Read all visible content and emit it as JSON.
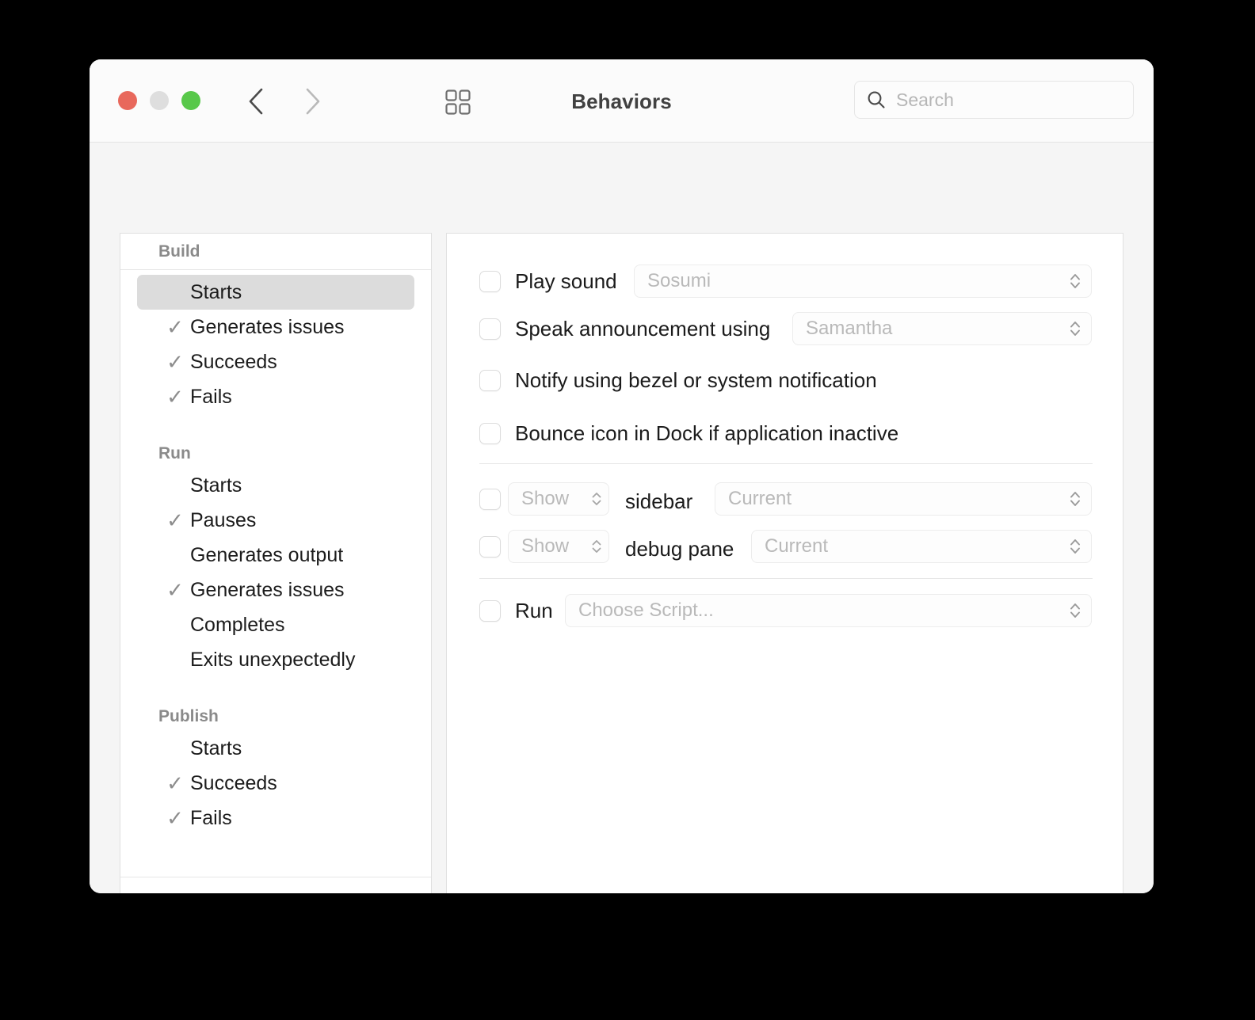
{
  "window": {
    "title": "Behaviors",
    "traffic_lights": {
      "close_color": "#e8685c",
      "minimize_color": "#dedede",
      "maximize_color": "#58c84a"
    },
    "toolbar": {
      "back_icon": "chevron-left-icon",
      "forward_icon": "chevron-right-icon",
      "grid_icon": "grid-view-icon"
    },
    "search": {
      "icon": "search-icon",
      "value": "",
      "placeholder": "Search"
    }
  },
  "sidebar": {
    "header_title": "Build",
    "groups": [
      {
        "name": "Build",
        "show_header_in_list": false,
        "items": [
          {
            "label": "Starts",
            "checked": false,
            "selected": true
          },
          {
            "label": "Generates issues",
            "checked": true,
            "selected": false
          },
          {
            "label": "Succeeds",
            "checked": true,
            "selected": false
          },
          {
            "label": "Fails",
            "checked": true,
            "selected": false
          }
        ]
      },
      {
        "name": "Run",
        "show_header_in_list": true,
        "items": [
          {
            "label": "Starts",
            "checked": false,
            "selected": false
          },
          {
            "label": "Pauses",
            "checked": true,
            "selected": false
          },
          {
            "label": "Generates output",
            "checked": false,
            "selected": false
          },
          {
            "label": "Generates issues",
            "checked": true,
            "selected": false
          },
          {
            "label": "Completes",
            "checked": false,
            "selected": false
          },
          {
            "label": "Exits unexpectedly",
            "checked": false,
            "selected": false
          }
        ]
      },
      {
        "name": "Publish",
        "show_header_in_list": true,
        "items": [
          {
            "label": "Starts",
            "checked": false,
            "selected": false
          },
          {
            "label": "Succeeds",
            "checked": true,
            "selected": false
          },
          {
            "label": "Fails",
            "checked": true,
            "selected": false
          }
        ]
      }
    ],
    "footer": {
      "add_label": "+",
      "remove_label": "–"
    },
    "checkmark_glyph": "✓"
  },
  "detail": {
    "play_sound": {
      "label": "Play sound",
      "checked": false,
      "popup_value": "Sosumi"
    },
    "speak_announcement": {
      "label": "Speak announcement using",
      "checked": false,
      "popup_value": "Samantha"
    },
    "notify_bezel": {
      "label": "Notify using bezel or system notification",
      "checked": false
    },
    "bounce_dock": {
      "label": "Bounce icon in Dock if application inactive",
      "checked": false
    },
    "sidebar_row": {
      "checked": false,
      "action_value": "Show",
      "label": "sidebar",
      "target_value": "Current"
    },
    "debug_pane_row": {
      "checked": false,
      "action_value": "Show",
      "label": "debug pane",
      "target_value": "Current"
    },
    "run_script": {
      "label": "Run",
      "checked": false,
      "popup_value": "Choose Script..."
    }
  }
}
